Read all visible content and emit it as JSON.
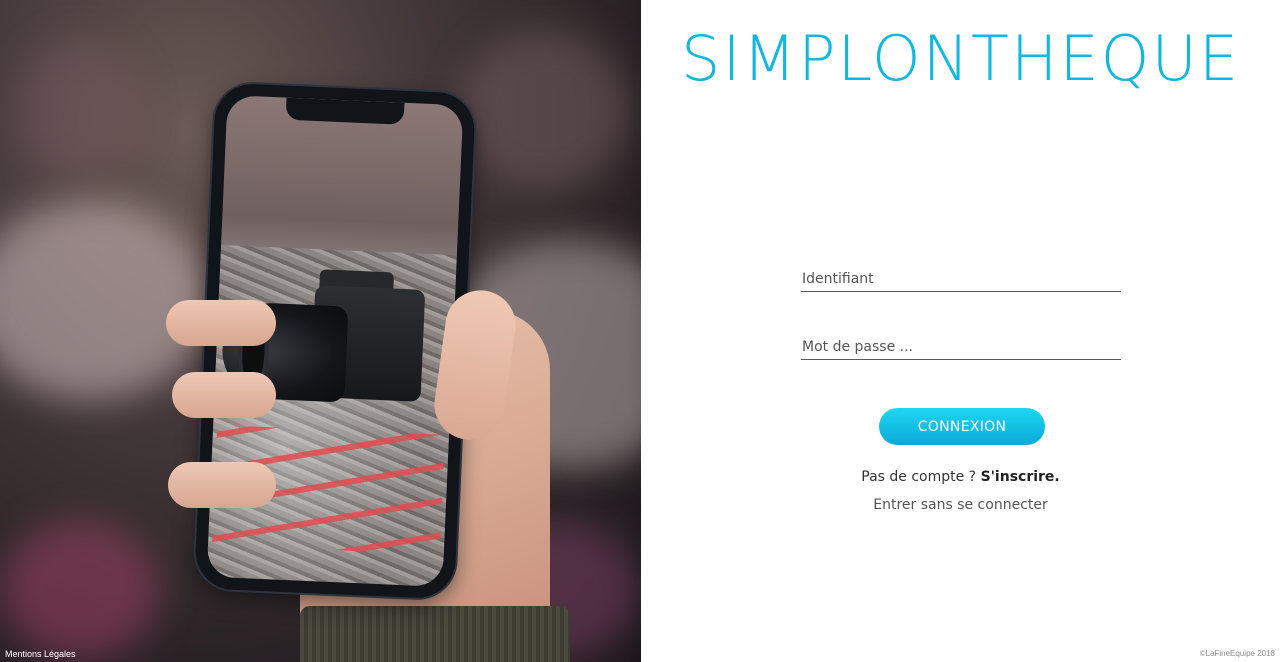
{
  "left_panel": {
    "legal_link": "Mentions Légales"
  },
  "login": {
    "brand_title": "SIMPLONTHEQUE",
    "username_placeholder": "Identifiant",
    "password_placeholder": "Mot de passe ...",
    "submit_label": "CONNEXION",
    "signup_prompt": "Pas de compte ? ",
    "signup_link": "S'inscrire.",
    "guest_link": "Entrer sans se connecter",
    "copyright": "©LaFineEquipe 2018"
  },
  "colors": {
    "brand": "#12b6de",
    "button_top": "#1ed6f2",
    "button_bottom": "#0aaad7"
  }
}
